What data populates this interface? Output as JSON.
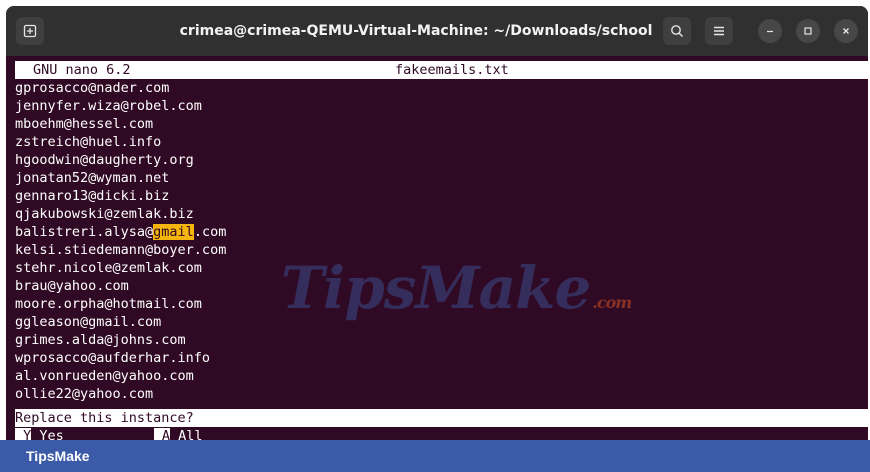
{
  "window": {
    "title": "crimea@crimea-QEMU-Virtual-Machine: ~/Downloads/school",
    "icons": {
      "new_tab": "new-tab-icon",
      "search": "search-icon",
      "menu": "hamburger-menu-icon",
      "minimize": "minimize-icon",
      "maximize": "maximize-icon",
      "close": "close-icon"
    }
  },
  "nano": {
    "version": "GNU nano 6.2",
    "filename": "fakeemails.txt"
  },
  "lines": [
    "gprosacco@nader.com",
    "jennyfer.wiza@robel.com",
    "mboehm@hessel.com",
    "zstreich@huel.info",
    "hgoodwin@daugherty.org",
    "jonatan52@wyman.net",
    "gennaro13@dicki.biz",
    "qjakubowski@zemlak.biz",
    "balistreri.alysa@gmail.com",
    "kelsi.stiedemann@boyer.com",
    "stehr.nicole@zemlak.com",
    "brau@yahoo.com",
    "moore.orpha@hotmail.com",
    "ggleason@gmail.com",
    "grimes.alda@johns.com",
    "wprosacco@aufderhar.info",
    "al.vonrueden@yahoo.com",
    "ollie22@yahoo.com"
  ],
  "highlight": {
    "line_index": 8,
    "before": "balistreri.alysa@",
    "match": "gmail",
    "after": ".com"
  },
  "prompt": "Replace this instance?",
  "options": {
    "yes_key": " Y",
    "yes_label": " Yes",
    "all_key": " A",
    "all_label": " All"
  },
  "watermark": {
    "text": "TipsMake",
    "suffix": ".com"
  },
  "footer": {
    "label": "TipsMake"
  },
  "colors": {
    "terminal_bg": "#300a24",
    "highlight": "#f5b50a",
    "footer_bg": "#3b5aa8"
  }
}
